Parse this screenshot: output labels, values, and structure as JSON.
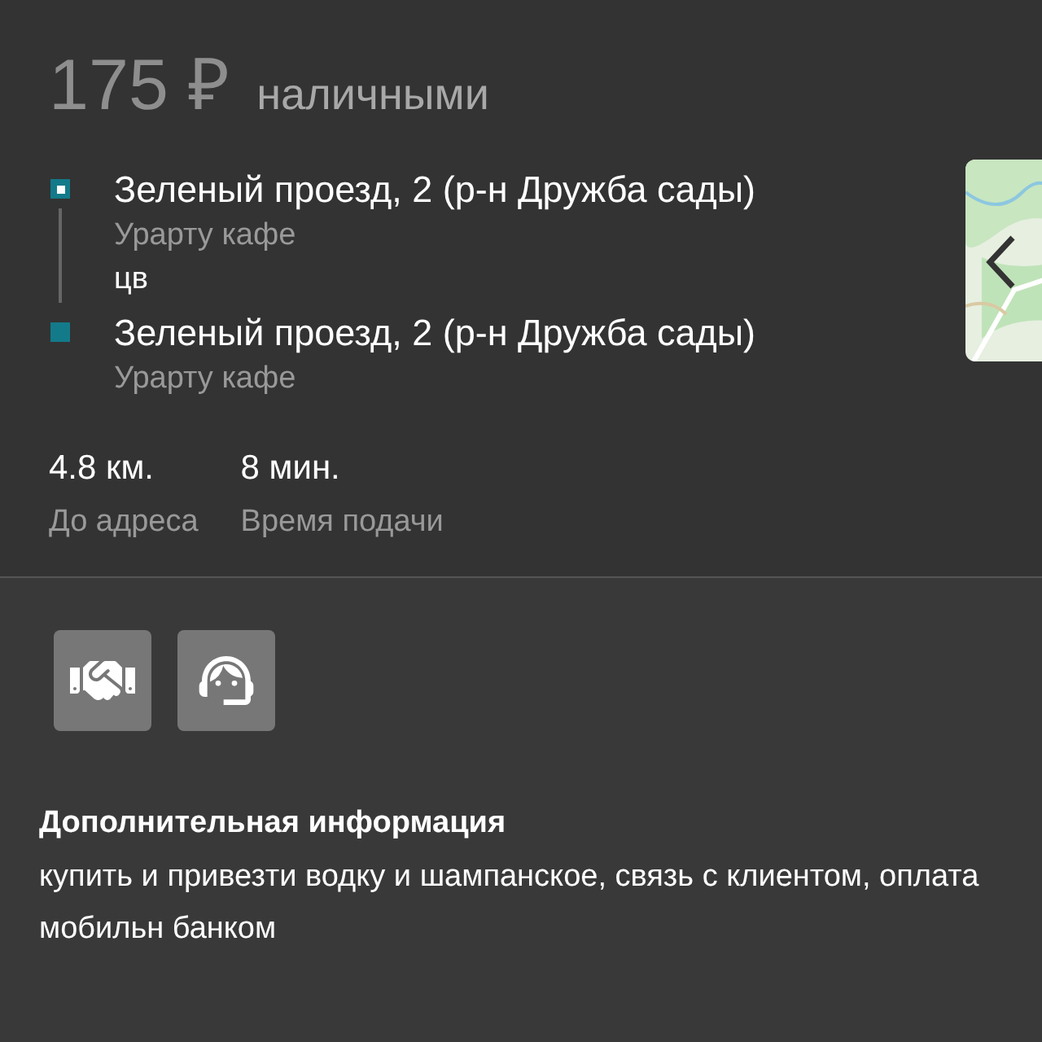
{
  "price": {
    "amount": "175 ₽",
    "payment": "наличными"
  },
  "route": [
    {
      "kind": "pickup",
      "address": "Зеленый проезд, 2 (р-н Дружба сады)",
      "place": "Урарту кафе",
      "note": "цв"
    },
    {
      "kind": "dropoff",
      "address": "Зеленый проезд, 2 (р-н Дружба сады)",
      "place": "Урарту кафе"
    }
  ],
  "stats": [
    {
      "value": "4.8 км.",
      "label": "До адреса"
    },
    {
      "value": "8 мин.",
      "label": "Время подачи"
    }
  ],
  "features": [
    {
      "kind": "handshake"
    },
    {
      "kind": "operator"
    }
  ],
  "extra_info": {
    "title": "Дополнительная информация",
    "text": "купить и привезти водку и шампанское, связь с клиентом, оплата мобильн банком"
  }
}
